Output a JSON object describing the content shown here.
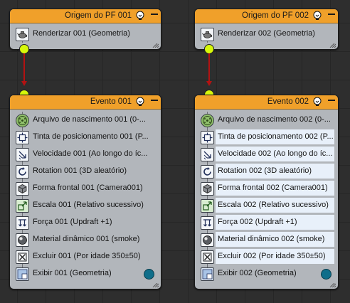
{
  "sources": [
    {
      "title": "Origem do PF 001",
      "row": {
        "icon": "teapot-icon",
        "label": "Renderizar 001 (Geometria)"
      }
    },
    {
      "title": "Origem do PF 002",
      "row": {
        "icon": "teapot-icon",
        "label": "Renderizar 002 (Geometria)"
      }
    }
  ],
  "events": [
    {
      "title": "Evento 001",
      "ops": [
        {
          "icon": "birth-icon",
          "label": "Arquivo de nascimento 001 (0-..."
        },
        {
          "icon": "position-icon",
          "label": "Tinta de posicionamento 001 (P..."
        },
        {
          "icon": "speed-icon",
          "label": "Velocidade 001 (Ao longo do íc..."
        },
        {
          "icon": "rotation-icon",
          "label": "Rotation 001 (3D aleatório)"
        },
        {
          "icon": "shape-icon",
          "label": "Forma frontal 001 (Camera001)"
        },
        {
          "icon": "scale-icon",
          "label": "Escala 001 (Relativo sucessivo)"
        },
        {
          "icon": "force-icon",
          "label": "Força 001 (Updraft +1)"
        },
        {
          "icon": "material-icon",
          "label": "Material dinâmico 001 (smoke)"
        },
        {
          "icon": "delete-icon",
          "label": "Excluir 001 (Por idade 350±50)"
        },
        {
          "icon": "display-icon",
          "label": "Exibir 001 (Geometria)"
        }
      ]
    },
    {
      "title": "Evento 002",
      "ops": [
        {
          "icon": "birth-icon",
          "label": "Arquivo de nascimento 002 (0-..."
        },
        {
          "icon": "position-icon",
          "label": "Tinta de posicionamento 002 (P..."
        },
        {
          "icon": "speed-icon",
          "label": "Velocidade 002 (Ao longo do íc..."
        },
        {
          "icon": "rotation-icon",
          "label": "Rotation 002 (3D aleatório)"
        },
        {
          "icon": "shape-icon",
          "label": "Forma frontal 002 (Camera001)"
        },
        {
          "icon": "scale-icon",
          "label": "Escala 002 (Relativo sucessivo)"
        },
        {
          "icon": "force-icon",
          "label": "Força 002 (Updraft +1)"
        },
        {
          "icon": "material-icon",
          "label": "Material dinâmico 002 (smoke)"
        },
        {
          "icon": "delete-icon",
          "label": "Excluir 002 (Por idade 350±50)"
        },
        {
          "icon": "display-icon",
          "label": "Exibir 002 (Geometria)"
        }
      ]
    }
  ],
  "colors": {
    "header": "#f0a02a",
    "node_body": "#b2b6bb",
    "port": "#d7f80a",
    "wire": "#b31212",
    "display_status": "#0f6e8a",
    "selected_row": "#e8f0fa"
  }
}
